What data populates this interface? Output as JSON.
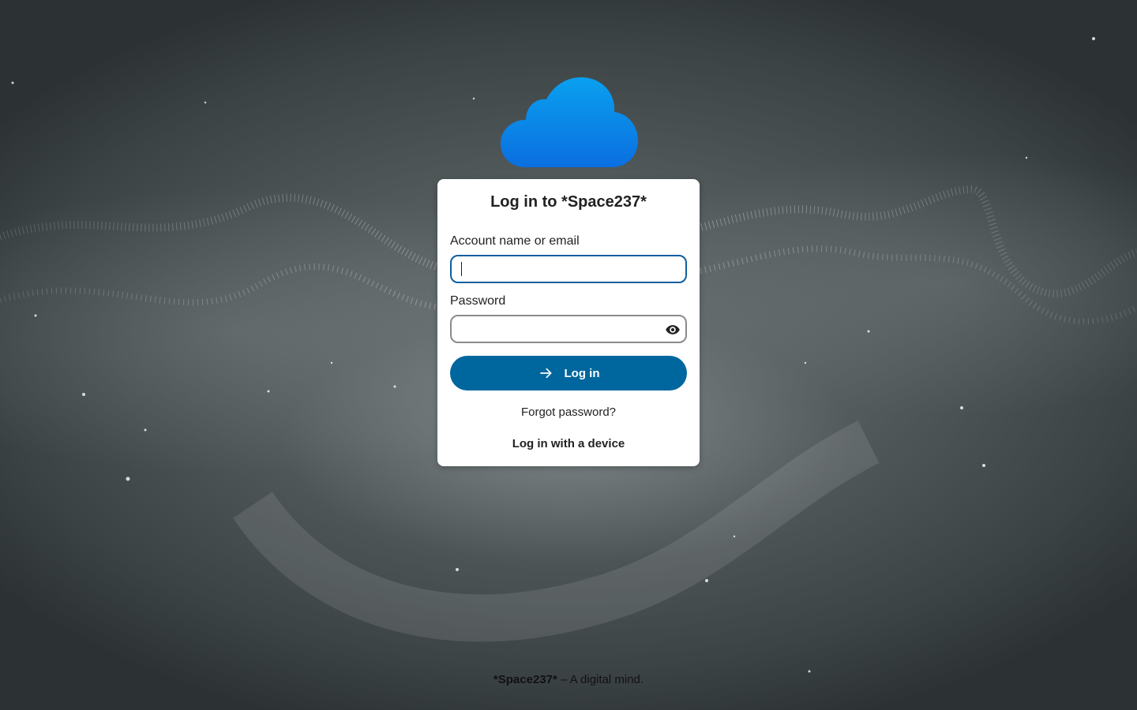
{
  "branding": {
    "logo_icon": "cloud-icon",
    "brand_color": "#0082c9"
  },
  "login": {
    "title": "Log in to *Space237*",
    "username_label": "Account name or email",
    "username_value": "",
    "password_label": "Password",
    "password_value": "",
    "show_password_icon": "eye-icon",
    "submit_icon": "arrow-right-icon",
    "submit_label": "Log in",
    "forgot_password": "Forgot password?",
    "device_login": "Log in with a device"
  },
  "footer": {
    "brand": "*Space237*",
    "tagline": " – A digital mind."
  },
  "colors": {
    "primary_button": "#00679e",
    "focus_border": "#0d5fa0"
  }
}
